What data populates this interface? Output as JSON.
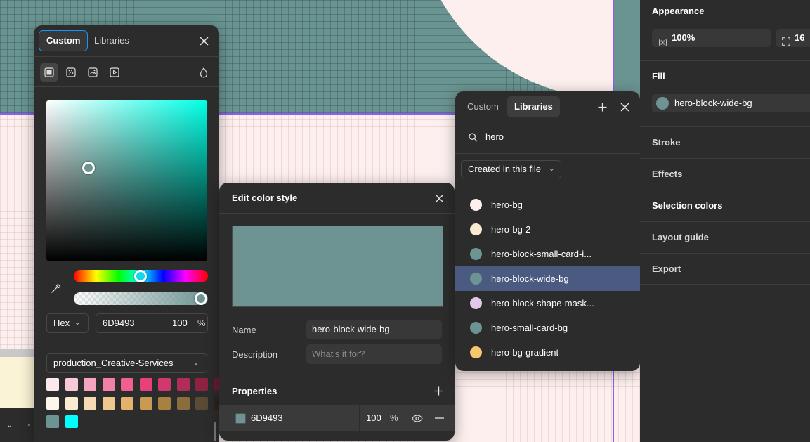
{
  "picker": {
    "tabs": [
      "Custom",
      "Libraries"
    ],
    "fill_type_icons": [
      "solid-fill-icon",
      "gradient-fill-icon",
      "image-fill-icon",
      "video-fill-icon"
    ],
    "color_format": "Hex",
    "hex": "6D9493",
    "opacity": "100",
    "percent": "%",
    "library": "production_Creative-Services",
    "swatches": [
      "#fbe9ee",
      "#f9c9d8",
      "#f6a5bf",
      "#f281a6",
      "#ef5f90",
      "#e64179",
      "#d0396c",
      "#b02d58",
      "#8f2243",
      "#6d1834",
      "#fdf6ea",
      "#fbead3",
      "#f6d9b3",
      "#eec78f",
      "#e2b26d",
      "#c89a52",
      "#a7813f",
      "#8b6c3d",
      "#5b4a34",
      "#2a241c",
      "#6d9493",
      "#00ffff"
    ]
  },
  "edit": {
    "title": "Edit color style",
    "color": "#6D9493",
    "name_label": "Name",
    "name_value": "hero-block-wide-bg",
    "description_label": "Description",
    "description_placeholder": "What's it for?",
    "properties_label": "Properties",
    "prop_hex": "6D9493",
    "prop_opacity": "100",
    "prop_percent": "%"
  },
  "libraries": {
    "tabs": [
      "Custom",
      "Libraries"
    ],
    "search_value": "hero",
    "filter": "Created in this file",
    "items": [
      {
        "name": "hero-bg",
        "color": "#fcefee"
      },
      {
        "name": "hero-bg-2",
        "color": "#fbead3"
      },
      {
        "name": "hero-block-small-card-i...",
        "color": "#6d9493"
      },
      {
        "name": "hero-block-wide-bg",
        "color": "#6d9493",
        "selected": true
      },
      {
        "name": "hero-block-shape-mask...",
        "color": "#e3c8ec"
      },
      {
        "name": "hero-small-card-bg",
        "color": "#6d9493"
      },
      {
        "name": "hero-bg-gradient",
        "color": "#f6c86e"
      }
    ]
  },
  "sidebar": {
    "appearance": "Appearance",
    "opacity": "100%",
    "radius": "16",
    "fill": "Fill",
    "fill_style": "hero-block-wide-bg",
    "stroke": "Stroke",
    "effects": "Effects",
    "selection_colors": "Selection colors",
    "layout_guide": "Layout guide",
    "export": "Export"
  }
}
